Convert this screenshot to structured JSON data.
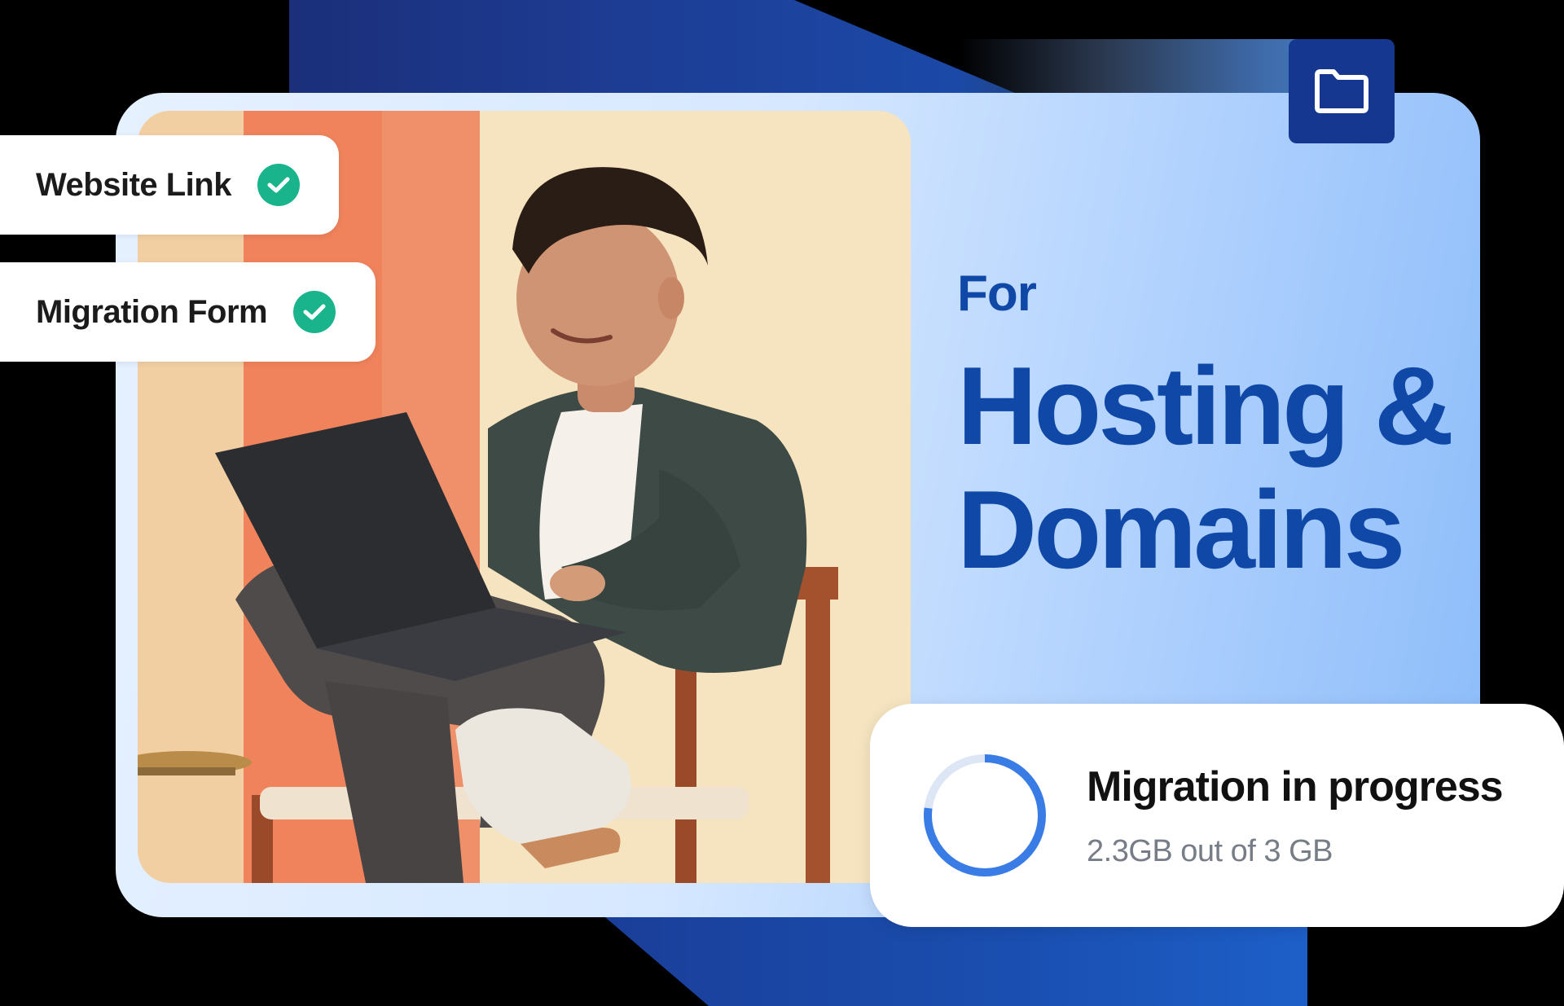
{
  "colors": {
    "background": "#000000",
    "accent_blue": "#0f48a6",
    "folder_badge": "#15378f",
    "check_green": "#19b48b",
    "progress_blue": "#3a7ce6"
  },
  "folder": {
    "icon": "folder-icon"
  },
  "headline": {
    "line1": "For",
    "line2": "Hosting &",
    "line3": "Domains"
  },
  "checklist": [
    {
      "label": "Website Link",
      "icon": "check-circle-icon"
    },
    {
      "label": "Migration Form",
      "icon": "check-circle-icon"
    }
  ],
  "migration": {
    "title": "Migration in progress",
    "detail": "2.3GB out of 3 GB",
    "progress_fraction": 0.77
  }
}
